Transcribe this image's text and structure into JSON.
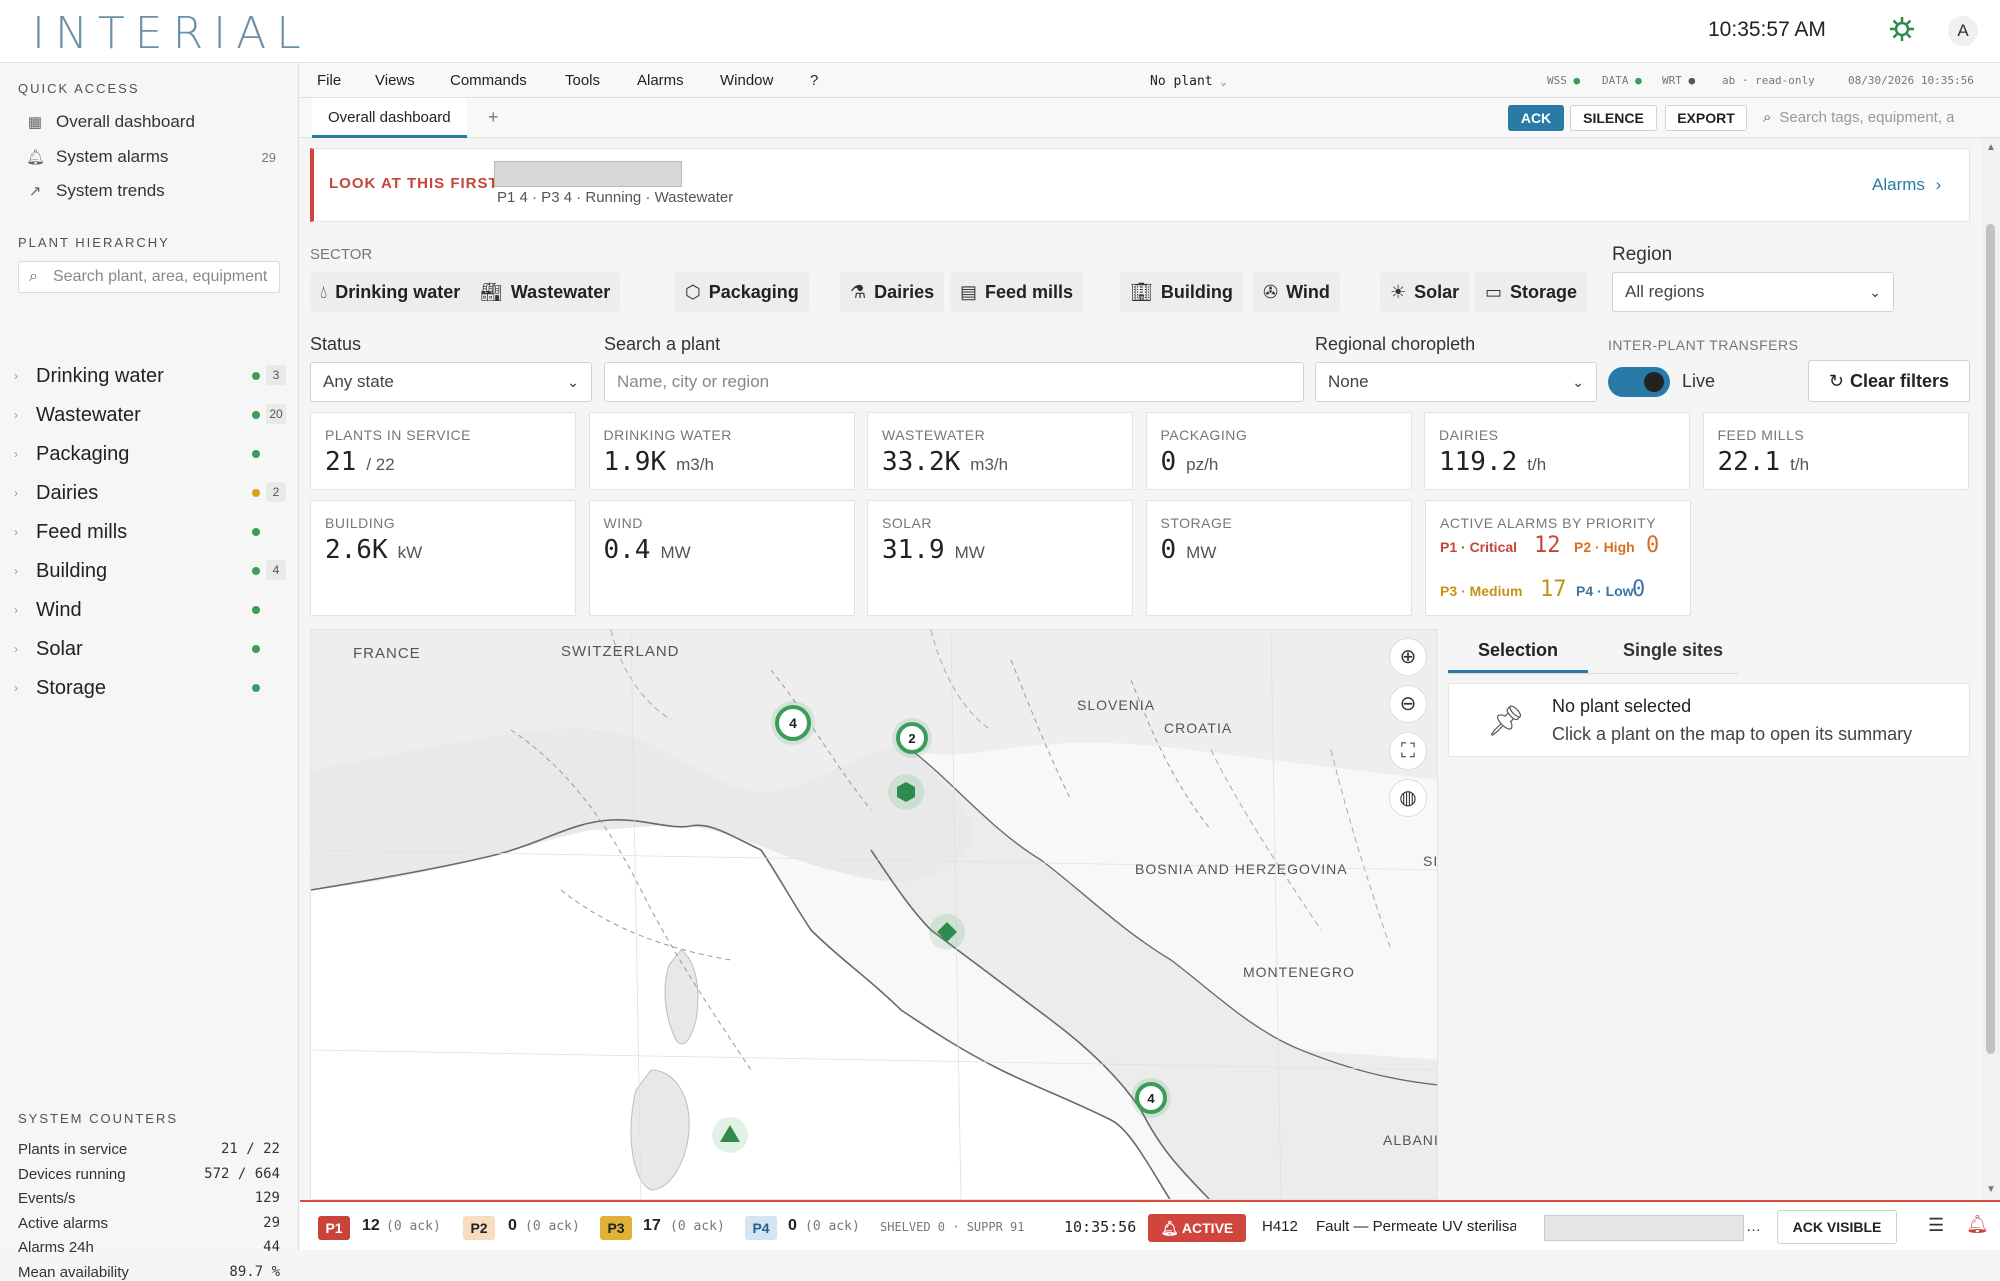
{
  "app": {
    "logo": "INTERIAL",
    "clock": "10:35:57 AM",
    "avatar": "A"
  },
  "sidebar": {
    "quick_access_title": "QUICK ACCESS",
    "quick_access": [
      {
        "label": "Overall dashboard"
      },
      {
        "label": "System alarms",
        "count": "29"
      },
      {
        "label": "System trends"
      }
    ],
    "hierarchy_title": "PLANT HIERARCHY",
    "search_placeholder": "Search plant, area, equipment",
    "tree": [
      {
        "label": "Drinking water",
        "status": "#3a9e5a",
        "count": "3"
      },
      {
        "label": "Wastewater",
        "status": "#3a9e5a",
        "count": "20"
      },
      {
        "label": "Packaging",
        "status": "#3a9e5a"
      },
      {
        "label": "Dairies",
        "status": "#d8a21c",
        "count": "2"
      },
      {
        "label": "Feed mills",
        "status": "#3a9e5a"
      },
      {
        "label": "Building",
        "status": "#3a9e5a",
        "count": "4"
      },
      {
        "label": "Wind",
        "status": "#3a9e5a"
      },
      {
        "label": "Solar",
        "status": "#3a9e5a"
      },
      {
        "label": "Storage",
        "status": "#3a9e5a"
      }
    ],
    "counters_title": "SYSTEM COUNTERS",
    "counters": [
      {
        "label": "Plants in service",
        "value": "21 / 22"
      },
      {
        "label": "Devices running",
        "value": "572 / 664"
      },
      {
        "label": "Events/s",
        "value": "129"
      },
      {
        "label": "Active alarms",
        "value": "29"
      },
      {
        "label": "Alarms 24h",
        "value": "44"
      },
      {
        "label": "Mean availability",
        "value": "89.7 %"
      }
    ]
  },
  "menubar": {
    "items": [
      "File",
      "Views",
      "Commands",
      "Tools",
      "Alarms",
      "Window",
      "?"
    ],
    "plant_selector": "No plant",
    "wss": "WSS",
    "data": "DATA",
    "wrt": "WRT",
    "user": "ab · read-only",
    "datetime": "08/30/2026 10:35:56"
  },
  "tabs": {
    "active": "Overall dashboard",
    "add": "+",
    "ack": "ACK",
    "silence": "SILENCE",
    "export": "EXPORT",
    "search_placeholder": "Search tags, equipment, a"
  },
  "look_first": {
    "title": "LOOK AT THIS FIRST",
    "summary": "P1 4 · P3 4 · Running · Wastewater",
    "link": "Alarms"
  },
  "filters": {
    "sector_label": "SECTOR",
    "sectors": [
      {
        "label": "Drinking water",
        "icon": "droplet-icon"
      },
      {
        "label": "Wastewater",
        "icon": "factory-icon"
      },
      {
        "label": "Packaging",
        "icon": "box-icon"
      },
      {
        "label": "Dairies",
        "icon": "dairy-icon"
      },
      {
        "label": "Feed mills",
        "icon": "silo-icon"
      },
      {
        "label": "Building",
        "icon": "building-icon"
      },
      {
        "label": "Wind",
        "icon": "fan-icon"
      },
      {
        "label": "Solar",
        "icon": "sun-icon"
      },
      {
        "label": "Storage",
        "icon": "battery-icon"
      }
    ],
    "region_label": "Region",
    "region_value": "All regions",
    "status_label": "Status",
    "status_value": "Any state",
    "search_label": "Search a plant",
    "search_placeholder": "Name, city or region",
    "choropleth_label": "Regional choropleth",
    "choropleth_value": "None",
    "transfers_label": "INTER-PLANT TRANSFERS",
    "live_label": "Live",
    "clear_label": "Clear filters"
  },
  "kpis": [
    {
      "label": "PLANTS IN SERVICE",
      "value": "21",
      "unit": "/ 22"
    },
    {
      "label": "DRINKING WATER",
      "value": "1.9K",
      "unit": "m3/h"
    },
    {
      "label": "WASTEWATER",
      "value": "33.2K",
      "unit": "m3/h"
    },
    {
      "label": "PACKAGING",
      "value": "0",
      "unit": "pz/h"
    },
    {
      "label": "DAIRIES",
      "value": "119.2",
      "unit": "t/h"
    },
    {
      "label": "FEED MILLS",
      "value": "22.1",
      "unit": "t/h"
    },
    {
      "label": "BUILDING",
      "value": "2.6K",
      "unit": "kW"
    },
    {
      "label": "WIND",
      "value": "0.4",
      "unit": "MW"
    },
    {
      "label": "SOLAR",
      "value": "31.9",
      "unit": "MW"
    },
    {
      "label": "STORAGE",
      "value": "0",
      "unit": "MW"
    }
  ],
  "alarms_priority": {
    "title": "ACTIVE ALARMS BY PRIORITY",
    "p1_label": "P1 · Critical",
    "p1": "12",
    "p2_label": "P2 · High",
    "p2": "0",
    "p3_label": "P3 · Medium",
    "p3": "17",
    "p4_label": "P4 · Low",
    "p4": "0"
  },
  "map": {
    "labels": [
      "FRANCE",
      "SWITZERLAND",
      "SLOVENIA",
      "CROATIA",
      "BOSNIA AND HERZEGOVINA",
      "MONTENEGRO",
      "ALBANI",
      "SI"
    ],
    "clusters": [
      "4",
      "2",
      "4"
    ]
  },
  "panel": {
    "tab_selection": "Selection",
    "tab_single": "Single sites",
    "empty_title": "No plant selected",
    "empty_hint": "Click a plant on the map to open its summary"
  },
  "alarmbar": {
    "p1": "P1",
    "p1_count": "12",
    "p1_ack": "(0 ack)",
    "p2": "P2",
    "p2_count": "0",
    "p2_ack": "(0 ack)",
    "p3": "P3",
    "p3_count": "17",
    "p3_ack": "(0 ack)",
    "p4": "P4",
    "p4_count": "0",
    "p4_ack": "(0 ack)",
    "shelved": "SHELVED 0 · SUPPR 91",
    "time": "10:35:56",
    "active": "ACTIVE",
    "code": "H412",
    "message": "Fault — Permeate UV sterilisation",
    "ellipsis": "…",
    "ack_visible": "ACK VISIBLE"
  }
}
